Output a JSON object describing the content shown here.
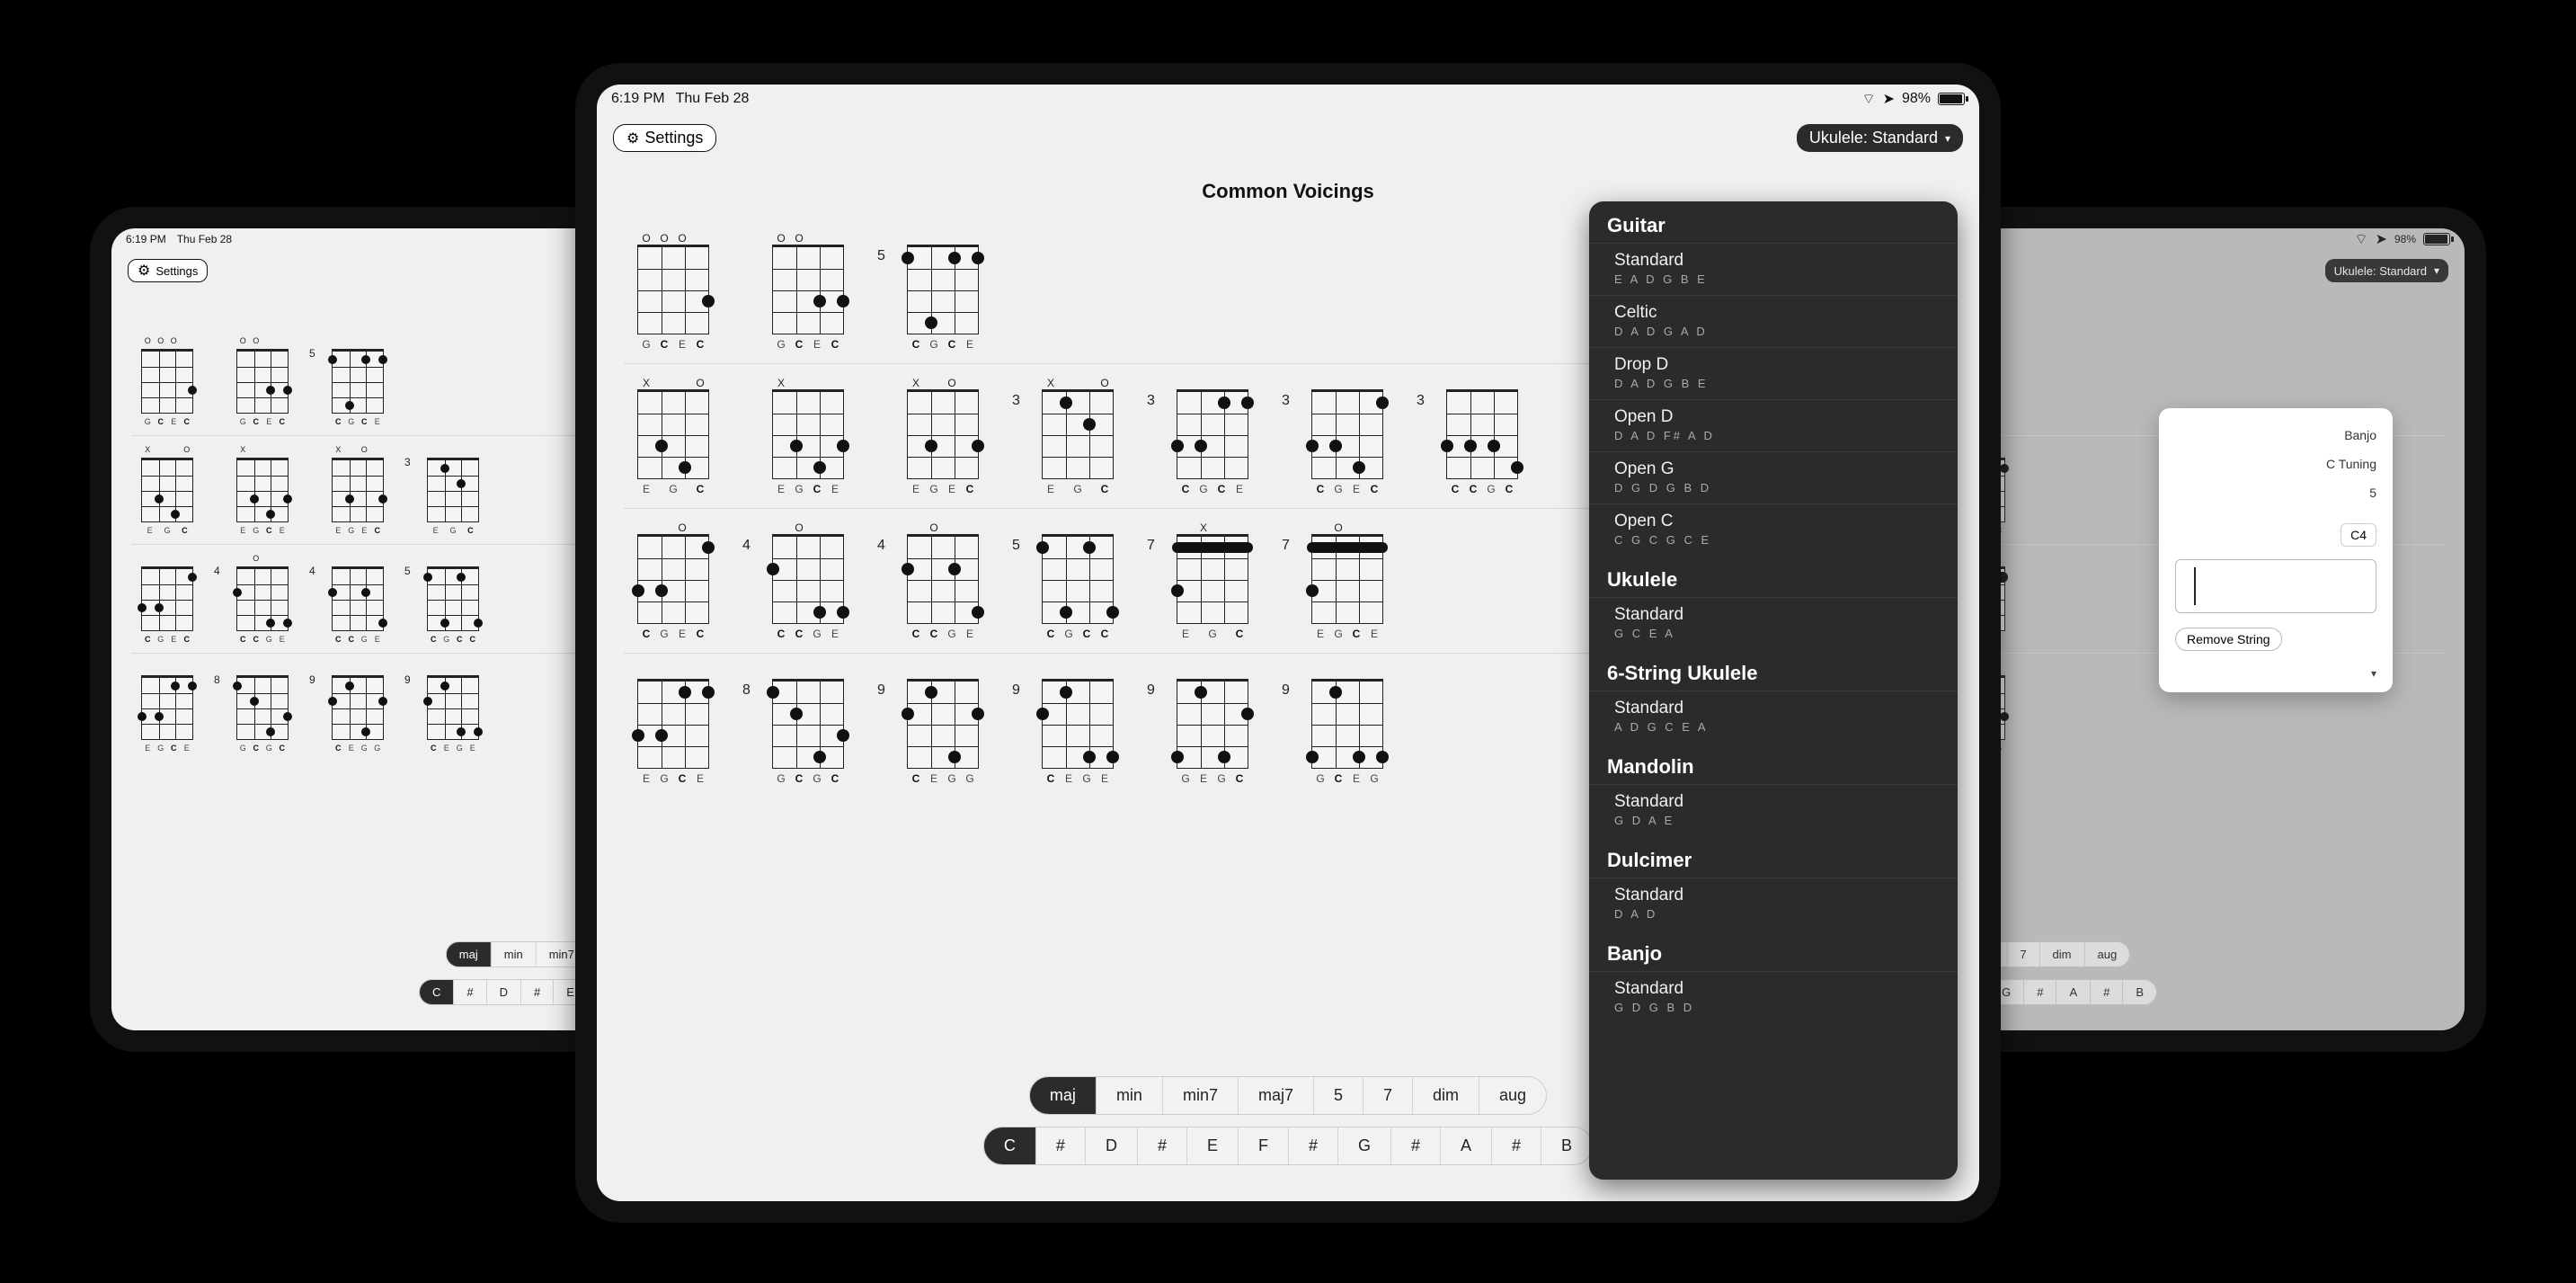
{
  "status": {
    "time": "6:19 PM",
    "date": "Thu Feb 28",
    "battery_pct": "98%"
  },
  "toolbar": {
    "settings_label": "Settings",
    "tuning_label": "Ukulele: Standard"
  },
  "section_title": "Common Voicings",
  "chord_types": [
    "maj",
    "min",
    "min7",
    "maj7",
    "5",
    "7",
    "dim",
    "aug"
  ],
  "roots": [
    "C",
    "#",
    "D",
    "#",
    "E",
    "F",
    "#",
    "G",
    "#",
    "A",
    "#",
    "B"
  ],
  "chord_type_active": "maj",
  "root_active": "C",
  "note_row_cegc": [
    "G",
    "C",
    "E",
    "C"
  ],
  "note_row_egc": [
    "E",
    "G",
    "C"
  ],
  "note_row_cgce": [
    "C",
    "G",
    "C",
    "E"
  ],
  "note_row_egce": [
    "E",
    "G",
    "C",
    "E"
  ],
  "note_row_egec": [
    "E",
    "G",
    "E",
    "C"
  ],
  "note_row_gceg": [
    "G",
    "C",
    "E",
    "G"
  ],
  "note_row_cgeg": [
    "C",
    "G",
    "E",
    "G"
  ],
  "note_row_cceg": [
    "C",
    "C",
    "E",
    "G"
  ],
  "note_row_ccge": [
    "C",
    "C",
    "G",
    "E"
  ],
  "note_row_cgcc": [
    "C",
    "G",
    "C",
    "C"
  ],
  "note_row_cgec": [
    "C",
    "G",
    "E",
    "C"
  ],
  "note_row_gcgc": [
    "G",
    "C",
    "G",
    "C"
  ],
  "note_row_ccgc": [
    "C",
    "C",
    "G",
    "C"
  ],
  "note_row_cegg": [
    "C",
    "E",
    "G",
    "G"
  ],
  "note_row_cege": [
    "C",
    "E",
    "G",
    "E"
  ],
  "note_row_gegc": [
    "G",
    "E",
    "G",
    "C"
  ],
  "note_row_gcec": [
    "G",
    "C",
    "E",
    "C"
  ],
  "tuning_menu": {
    "groups": [
      {
        "title": "Guitar",
        "items": [
          {
            "name": "Standard",
            "notes": "E A D G B E"
          },
          {
            "name": "Celtic",
            "notes": "D A D G A D"
          },
          {
            "name": "Drop D",
            "notes": "D A D G B E"
          },
          {
            "name": "Open D",
            "notes": "D A D F# A D"
          },
          {
            "name": "Open G",
            "notes": "D G D G B D"
          },
          {
            "name": "Open C",
            "notes": "C G C G C E"
          }
        ]
      },
      {
        "title": "Ukulele",
        "items": [
          {
            "name": "Standard",
            "notes": "G C E A"
          }
        ]
      },
      {
        "title": "6-String Ukulele",
        "items": [
          {
            "name": "Standard",
            "notes": "A D G C E A"
          }
        ]
      },
      {
        "title": "Mandolin",
        "items": [
          {
            "name": "Standard",
            "notes": "G D A E"
          }
        ]
      },
      {
        "title": "Dulcimer",
        "items": [
          {
            "name": "Standard",
            "notes": "D A D"
          }
        ]
      },
      {
        "title": "Banjo",
        "items": [
          {
            "name": "Standard",
            "notes": "G D G B D"
          }
        ]
      }
    ]
  },
  "right_popover": {
    "instrument": "Banjo",
    "tuning_label": "C Tuning",
    "strings": "5",
    "note_key": "C4",
    "remove_string": "Remove String"
  }
}
